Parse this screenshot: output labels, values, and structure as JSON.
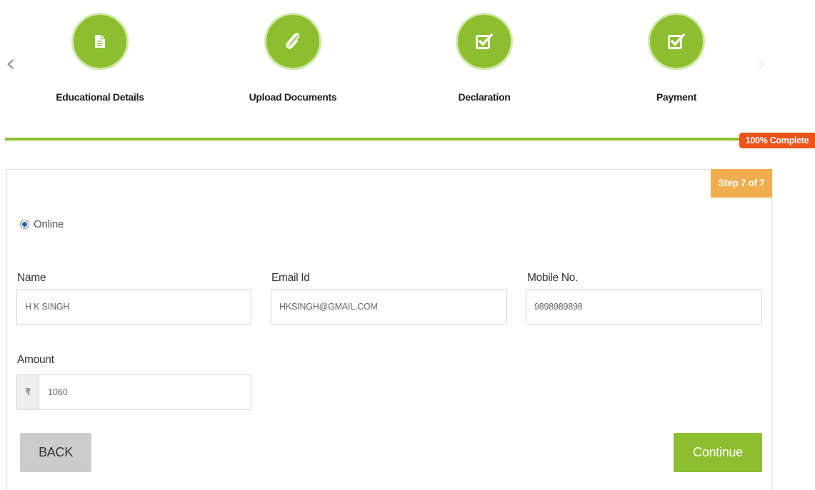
{
  "carousel": {
    "prev_arrow": "‹",
    "next_arrow": "›"
  },
  "steps": [
    {
      "label": "Educational Details",
      "icon": "document-icon"
    },
    {
      "label": "Upload Documents",
      "icon": "paperclip-icon"
    },
    {
      "label": "Declaration",
      "icon": "checkbox-icon"
    },
    {
      "label": "Payment",
      "icon": "checkbox-icon"
    }
  ],
  "progress": {
    "value": 1.0,
    "label": "100% Complete",
    "bar_color": "#8cbe2f",
    "badge_color": "#f0521c"
  },
  "panel": {
    "step_badge": "Step 7 of 7",
    "step_badge_color": "#f0ad4e",
    "payment_mode": "Online"
  },
  "form": {
    "name": {
      "label": "Name",
      "value": "H K SINGH"
    },
    "email": {
      "label": "Email Id",
      "value": "HKSINGH@GMAIL.COM"
    },
    "mobile": {
      "label": "Mobile No.",
      "value": "9898989898"
    },
    "amount": {
      "label": "Amount",
      "currency_symbol": "₹",
      "value": "1060"
    }
  },
  "buttons": {
    "back": "BACK",
    "continue": "Continue"
  },
  "colors": {
    "accent": "#8cbe2f"
  }
}
